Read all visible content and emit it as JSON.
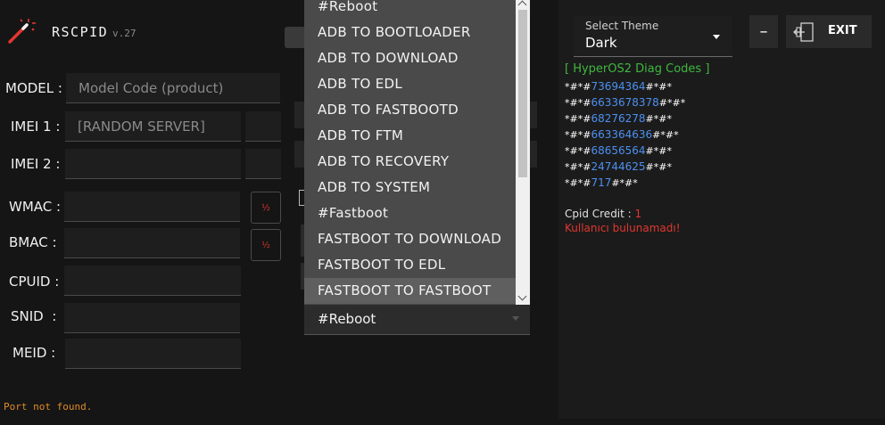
{
  "app": {
    "title": "RSCPID",
    "version": "v.27",
    "wand_icon": "magic-wand-icon",
    "accent": "#e0372f"
  },
  "form": {
    "model_label": "MODEL :",
    "model_placeholder": "Model Code (product)",
    "imei1_label": "IMEI 1 :",
    "imei1_placeholder": "[RANDOM SERVER]",
    "imei2_label": "IMEI 2 :",
    "wmac_label": "WMAC :",
    "bmac_label": "BMAC :",
    "cpuid_label": "CPUID :",
    "snid_label": "SNID  :",
    "meid_label": "MEID :",
    "half_symbol": "½"
  },
  "dropdown": {
    "items": [
      "#Reboot",
      "ADB TO BOOTLOADER",
      "ADB TO DOWNLOAD",
      "ADB TO EDL",
      "ADB TO FASTBOOTD",
      "ADB TO FTM",
      "ADB TO RECOVERY",
      "ADB TO SYSTEM",
      "#Fastboot",
      "FASTBOOT TO DOWNLOAD",
      "FASTBOOT TO EDL",
      "FASTBOOT TO FASTBOOT"
    ],
    "highlighted_index": 11,
    "selected_value": "#Reboot",
    "scroll_up_icon": "chevron-up-icon",
    "scroll_down_icon": "chevron-down-icon"
  },
  "theme": {
    "label": "Select Theme",
    "value": "Dark",
    "caret_icon": "caret-down-icon"
  },
  "window": {
    "minimize_label": "–",
    "exit_label": "EXIT",
    "exit_icon": "exit-door-icon"
  },
  "diag": {
    "title": "[ HyperOS2 Diag Codes ]",
    "codes": [
      {
        "pre": "*#*#",
        "num": "73694364",
        "post": "#*#*"
      },
      {
        "pre": "*#*#",
        "num": "6633678378",
        "post": "#*#*"
      },
      {
        "pre": "*#*#",
        "num": "68276278",
        "post": "#*#*"
      },
      {
        "pre": "*#*#",
        "num": "663364636",
        "post": "#*#*"
      },
      {
        "pre": "*#*#",
        "num": "68656564",
        "post": "#*#*"
      },
      {
        "pre": "*#*#",
        "num": "24744625",
        "post": "#*#*"
      },
      {
        "pre": "*#*#",
        "num": "717",
        "post": "#*#*"
      }
    ],
    "credit_label": "Cpid Credit :",
    "credit_value": "1",
    "user_status": "Kullanıcı bulunamadı!"
  },
  "status": {
    "text": "Port not found."
  },
  "colors": {
    "green": "#3fb83f",
    "blue": "#4d90f0",
    "red": "#e0372f",
    "status_orange": "#e08a2a"
  }
}
